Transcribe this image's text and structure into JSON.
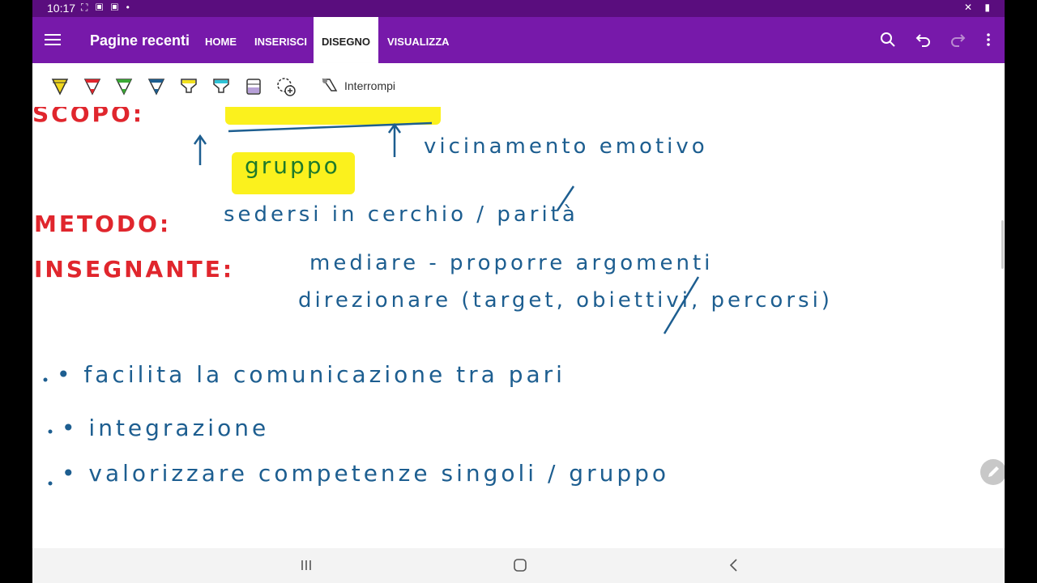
{
  "status_bar": {
    "time": "10:17"
  },
  "app_bar": {
    "title": "Pagine recenti",
    "tabs": [
      {
        "label": "HOME",
        "active": false
      },
      {
        "label": "INSERISCI",
        "active": false
      },
      {
        "label": "DISEGNO",
        "active": true
      },
      {
        "label": "VISUALIZZA",
        "active": false
      }
    ],
    "icons": [
      "search-icon",
      "undo-icon",
      "redo-icon",
      "more-icon"
    ]
  },
  "toolbar": {
    "pens": [
      {
        "name": "pen-yellow",
        "color": "#f2d81e"
      },
      {
        "name": "pen-red",
        "color": "#e0262d"
      },
      {
        "name": "pen-green",
        "color": "#3aa935"
      },
      {
        "name": "pen-blue",
        "color": "#1d5e90"
      },
      {
        "name": "highlighter-yellow",
        "color": "#f2e11e"
      },
      {
        "name": "highlighter-cyan",
        "color": "#2ec3d6"
      }
    ],
    "stop_label": "Interrompi"
  },
  "canvas": {
    "red_headings": [
      "SCOPO:",
      "METODO:",
      "INSEGNANTE:"
    ],
    "handwritten_lines": [
      "vicinamento emotivo",
      "gruppo",
      "sedersi in cerchio / parità",
      "mediare - proporre argomenti",
      "direzionare (target, obiettivi, percorsi)",
      "• facilita la comunicazione tra pari",
      "• integrazione",
      "• valorizzare competenze singoli / gruppo"
    ]
  },
  "colors": {
    "app_purple": "#7719aa",
    "status_purple": "#5a0d7e",
    "ink_blue": "#1d5e90",
    "ink_red": "#e0262d",
    "highlight_yellow": "#fbf11d"
  }
}
